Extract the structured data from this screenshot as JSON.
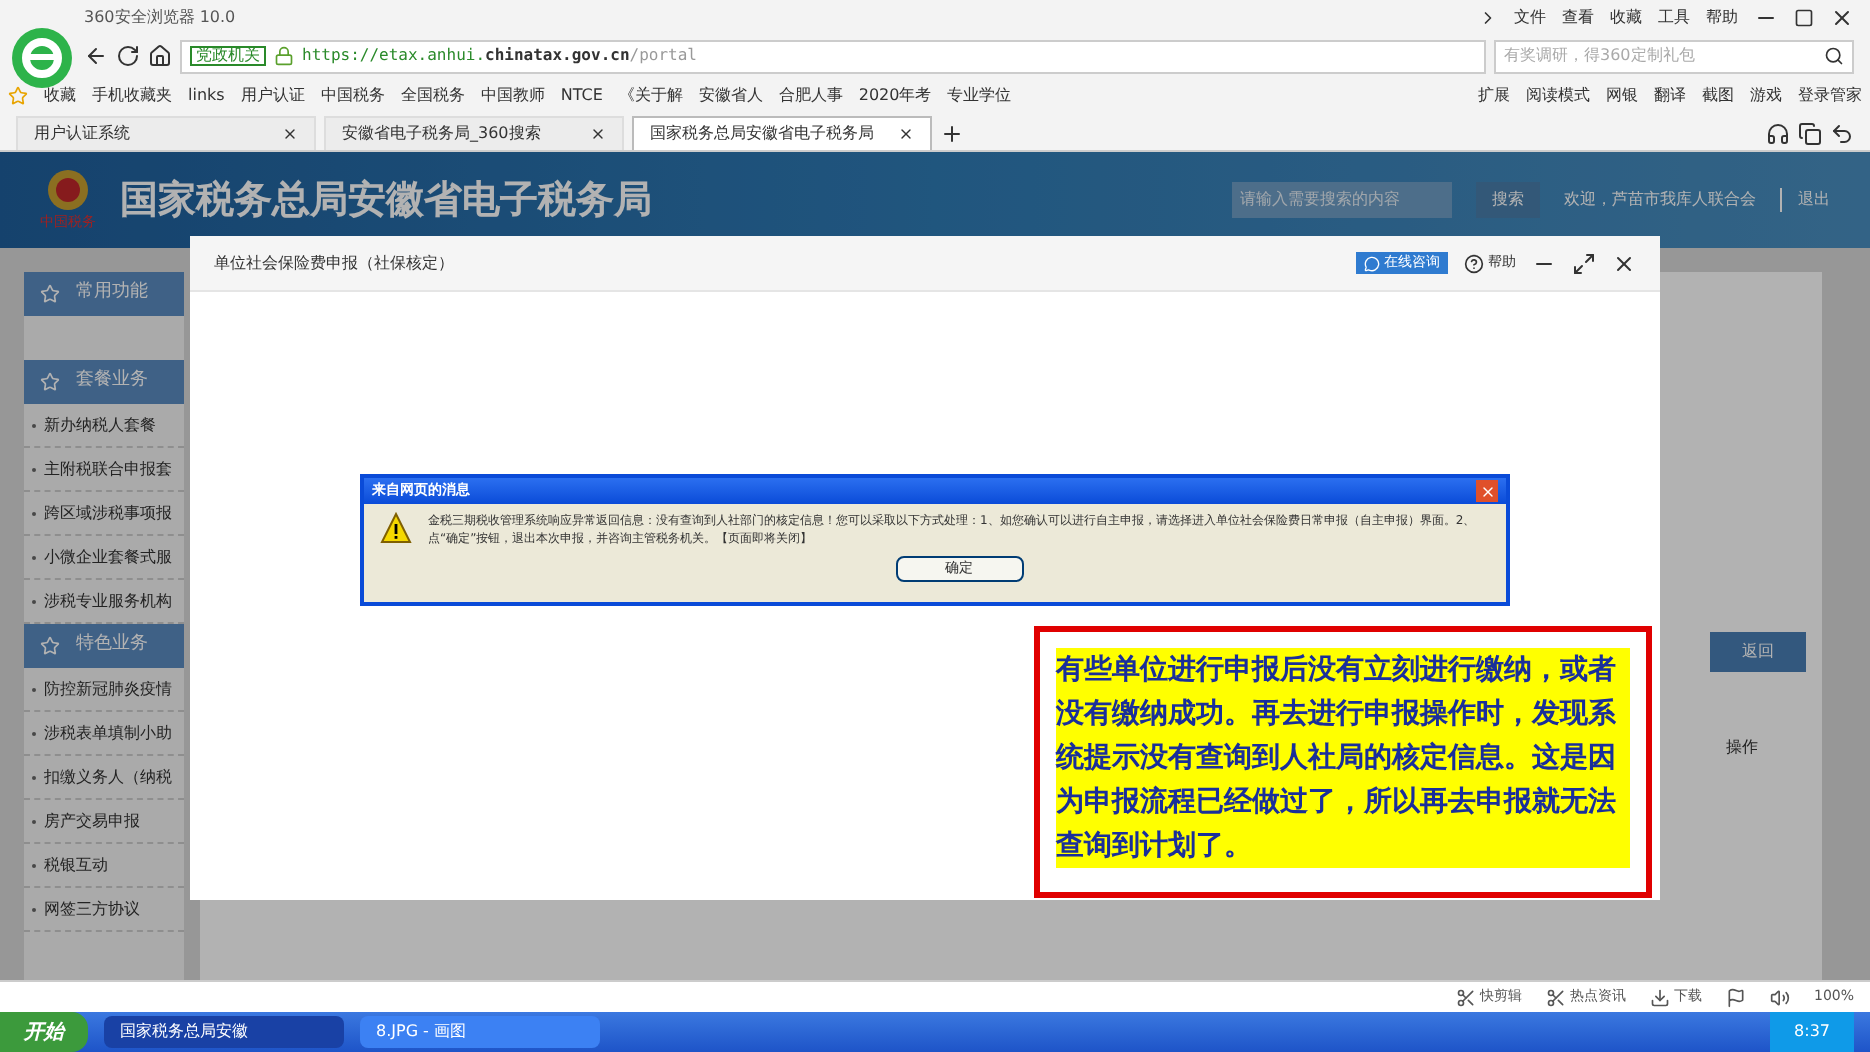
{
  "browser": {
    "app_title": "360安全浏览器 10.0",
    "menu": [
      "文件",
      "查看",
      "收藏",
      "工具",
      "帮助"
    ],
    "address": {
      "badge": "党政机关",
      "url_prefix": "https://etax.anhui.",
      "url_domain": "chinatax.gov.cn",
      "url_path": "/portal"
    },
    "search": {
      "placeholder": "有奖调研，得360定制礼包"
    },
    "bookmarks": [
      "收藏",
      "手机收藏夹",
      "links",
      "用户认证",
      "中国税务",
      "全国税务",
      "中国教师",
      "NTCE",
      "《关于解",
      "安徽省人",
      "合肥人事",
      "2020年考",
      "专业学位"
    ],
    "tools": [
      "扩展",
      "阅读模式",
      "网银",
      "翻译",
      "截图",
      "游戏",
      "登录管家"
    ],
    "tabs": [
      {
        "label": "用户认证系统",
        "selected": false
      },
      {
        "label": "安徽省电子税务局_360搜索",
        "selected": false
      },
      {
        "label": "国家税务总局安徽省电子税务局",
        "selected": true
      }
    ]
  },
  "site": {
    "title": "国家税务总局安徽省电子税务局",
    "logo_caption": "中国税务",
    "search": {
      "placeholder": "请输入需要搜索的内容",
      "button": "搜索"
    },
    "welcome": "欢迎，芦苗市我库人联合会",
    "logout": "退出"
  },
  "sidebar": {
    "sections": [
      {
        "title": "常用功能"
      },
      {
        "title": "套餐业务",
        "items": [
          "新办纳税人套餐",
          "主附税联合申报套",
          "跨区域涉税事项报",
          "小微企业套餐式服",
          "涉税专业服务机构"
        ]
      },
      {
        "title": "特色业务",
        "items": [
          "防控新冠肺炎疫情",
          "涉税表单填制小助",
          "扣缴义务人（纳税",
          "房产交易申报",
          "税银互动",
          "网签三方协议"
        ]
      }
    ]
  },
  "main": {
    "back_button": "返回",
    "column": "操作"
  },
  "modal": {
    "title": "单位社会保险费申报（社保核定）",
    "online_help": "在线咨询",
    "help": "帮助"
  },
  "alert": {
    "title": "来自网页的消息",
    "message": "金税三期税收管理系统响应异常返回信息：没有查询到人社部门的核定信息！您可以采取以下方式处理：1、如您确认可以进行自主申报，请选择进入单位社会保险费日常申报（自主申报）界面。2、点“确定”按钮，退出本次申报，并咨询主管税务机关。【页面即将关闭】",
    "ok": "确定"
  },
  "annotation": {
    "text": "有些单位进行申报后没有立刻进行缴纳，或者没有缴纳成功。再去进行申报操作时，发现系统提示没有查询到人社局的核定信息。这是因为申报流程已经做过了，所以再去申报就无法查询到计划了。"
  },
  "status_bar": {
    "items": [
      "快剪辑",
      "热点资讯",
      "下载"
    ],
    "zoom": "100%"
  },
  "taskbar": {
    "start": "开始",
    "tasks": [
      {
        "label": "国家税务总局安徽",
        "selected": true
      },
      {
        "label": "8.JPG - 画图",
        "selected": false
      }
    ],
    "clock": "8:37"
  }
}
